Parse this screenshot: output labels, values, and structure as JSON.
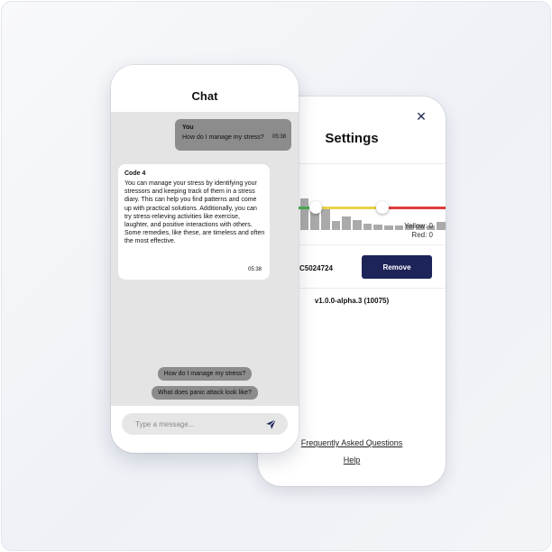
{
  "colors": {
    "accent": "#1d2458",
    "bubble_gray": "#8c8c8c",
    "chat_background": "#e4e4e4",
    "histogram_bar": "#aaaaaa",
    "range_green": "#4caf50",
    "range_yellow": "#e8d44a",
    "range_red": "#e03c3c"
  },
  "settings": {
    "title": "Settings",
    "close_icon": "close-icon",
    "histogram_levels": [
      0.5,
      0.68,
      0.92,
      0.9,
      0.88,
      0.72,
      0.64,
      0.24,
      0.38,
      0.28,
      0.18,
      0.16,
      0.12,
      0.12,
      0.14,
      0.14,
      0.12,
      0.22
    ],
    "legend_yellow": "Yellow: 0",
    "legend_red": "Red: 0",
    "serial": "C5024724",
    "remove_label": "Remove",
    "version": "v1.0.0-alpha.3 (10075)",
    "faq_label": "Frequently Asked Questions",
    "help_label": "Help"
  },
  "chat": {
    "title": "Chat",
    "messages": [
      {
        "sender": "You",
        "text": "How do I manage my stress?",
        "time": "05:38"
      },
      {
        "sender": "Code 4",
        "text": " You can manage your stress by identifying your stressors and keeping track of them in a stress diary. This can help you find patterns and come up with practical solutions. Additionally, you can try stress-relieving activities like exercise, laughter, and positive interactions with others. Some remedies, like these, are timeless and often the most effective.",
        "time": "05:38"
      }
    ],
    "suggestions": [
      "How do I manage my stress?",
      "What does panic attack look like?"
    ],
    "input_placeholder": "Type a message...",
    "send_icon": "send-icon"
  }
}
